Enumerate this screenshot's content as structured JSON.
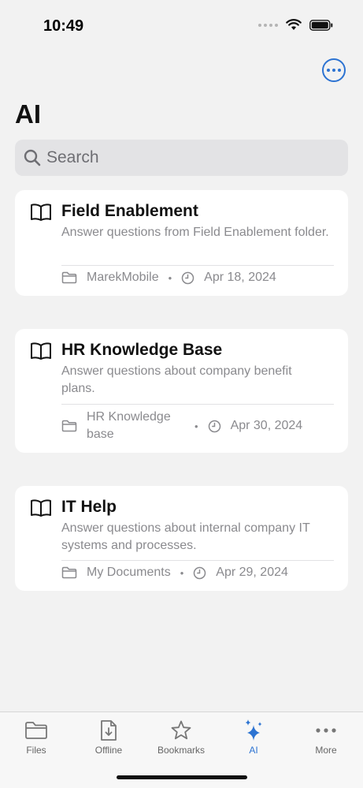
{
  "status_bar": {
    "time": "10:49"
  },
  "header": {
    "title": "AI",
    "more_icon": "ellipsis-circle-icon"
  },
  "search": {
    "placeholder": "Search"
  },
  "cards": [
    {
      "title": "Field Enablement",
      "description": "Answer questions from Field Enablement folder.",
      "folder": "MarekMobile",
      "date": "Apr 18, 2024"
    },
    {
      "title": "HR Knowledge Base",
      "description": "Answer questions about company benefit plans.",
      "folder": "HR Knowledge base",
      "date": "Apr 30, 2024"
    },
    {
      "title": "IT Help",
      "description": "Answer questions about internal company IT systems and processes.",
      "folder": "My Documents",
      "date": "Apr 29, 2024"
    }
  ],
  "meta_separator": "•",
  "tab_bar": {
    "tabs": [
      {
        "label": "Files",
        "icon": "folder-icon"
      },
      {
        "label": "Offline",
        "icon": "download-document-icon"
      },
      {
        "label": "Bookmarks",
        "icon": "star-icon"
      },
      {
        "label": "AI",
        "icon": "sparkles-icon",
        "active": true
      },
      {
        "label": "More",
        "icon": "ellipsis-icon"
      }
    ]
  },
  "colors": {
    "accent": "#2c73d2",
    "background": "#f2f2f2",
    "card": "#ffffff",
    "secondary_text": "#8a8a8e"
  }
}
